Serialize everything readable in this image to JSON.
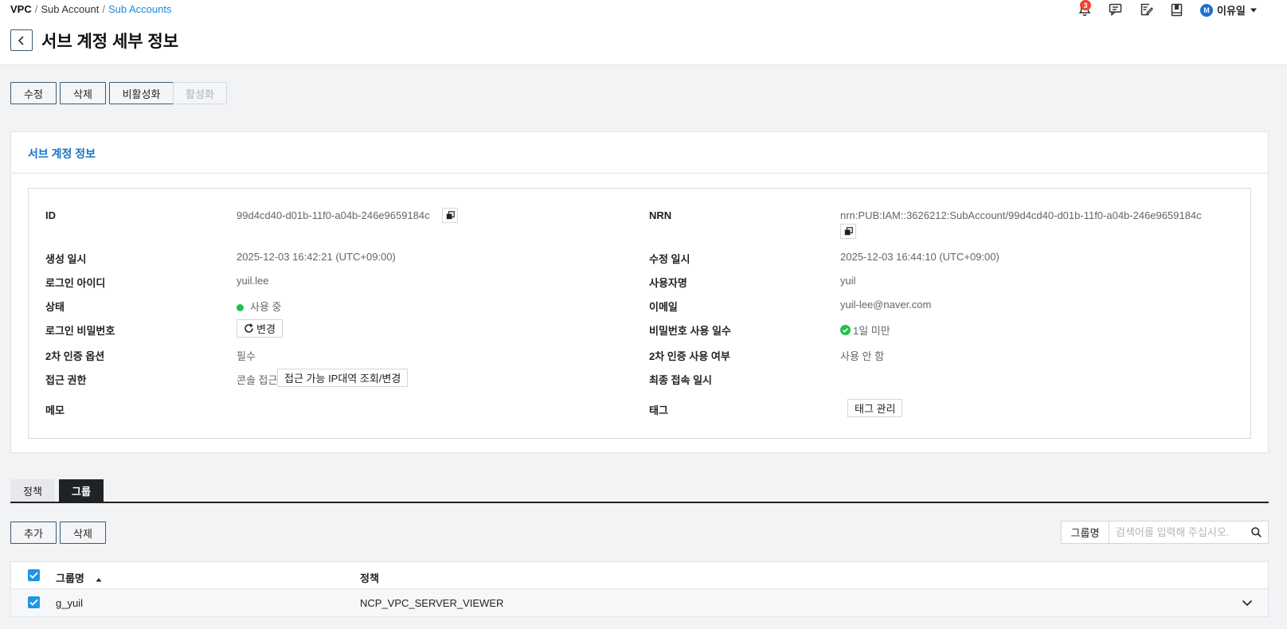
{
  "breadcrumb": {
    "items": [
      "VPC",
      "Sub Account",
      "Sub Accounts"
    ],
    "separator": "/"
  },
  "page": {
    "title": "서브 계정 세부 정보"
  },
  "header": {
    "notification_count": "3",
    "avatar_initial": "M",
    "user_name": "이유일"
  },
  "actions": [
    {
      "label": "수정",
      "disabled": false
    },
    {
      "label": "삭제",
      "disabled": false
    },
    {
      "label": "비활성화",
      "disabled": false
    },
    {
      "label": "활성화",
      "disabled": true
    }
  ],
  "panel": {
    "title": "서브 계정 정보",
    "fields": {
      "id": {
        "label": "ID",
        "value": "99d4cd40-d01b-11f0-a04b-246e9659184c"
      },
      "nrn": {
        "label": "NRN",
        "value": "nrn:PUB:IAM::3626212:SubAccount/99d4cd40-d01b-11f0-a04b-246e9659184c"
      },
      "created": {
        "label": "생성 일시",
        "value": "2025-12-03 16:42:21 (UTC+09:00)"
      },
      "modified": {
        "label": "수정 일시",
        "value": "2025-12-03 16:44:10 (UTC+09:00)"
      },
      "login_id": {
        "label": "로그인 아이디",
        "value": "yuil.lee"
      },
      "user_name": {
        "label": "사용자명",
        "value": "yuil"
      },
      "status": {
        "label": "상태",
        "value": "사용 중",
        "color": "#1fc24a"
      },
      "email": {
        "label": "이메일",
        "value": "yuil-lee@naver.com"
      },
      "password": {
        "label": "로그인 비밀번호",
        "button": "변경"
      },
      "password_days": {
        "label": "비밀번호 사용 일수",
        "value": "1일 미만",
        "color": "#1fc24a"
      },
      "mfa_option": {
        "label": "2차 인증 옵션",
        "value": "필수"
      },
      "mfa_use": {
        "label": "2차 인증 사용 여부",
        "value": "사용 안 함"
      },
      "access": {
        "label": "접근 권한",
        "value": "콘솔 접근",
        "button": "접근 가능 IP대역 조회/변경"
      },
      "last_login": {
        "label": "최종 접속 일시",
        "value": ""
      },
      "memo": {
        "label": "메모",
        "value": ""
      },
      "tag": {
        "label": "태그",
        "button": "태그 관리"
      }
    }
  },
  "tabs": [
    {
      "label": "정책",
      "active": false
    },
    {
      "label": "그룹",
      "active": true
    }
  ],
  "group_actions": [
    {
      "label": "추가"
    },
    {
      "label": "삭제"
    }
  ],
  "search": {
    "field_label": "그룹명",
    "placeholder": "검색어를 입력해 주십시오."
  },
  "table": {
    "columns": [
      "그룹명",
      "정책"
    ],
    "rows": [
      {
        "group": "g_yuil",
        "policy": "NCP_VPC_SERVER_VIEWER",
        "checked": true
      }
    ],
    "all_checked": true
  },
  "colors": {
    "accent": "#1a73c7",
    "link": "#1e88d6",
    "checkbox": "#2196e3",
    "badge": "#f0452d"
  }
}
